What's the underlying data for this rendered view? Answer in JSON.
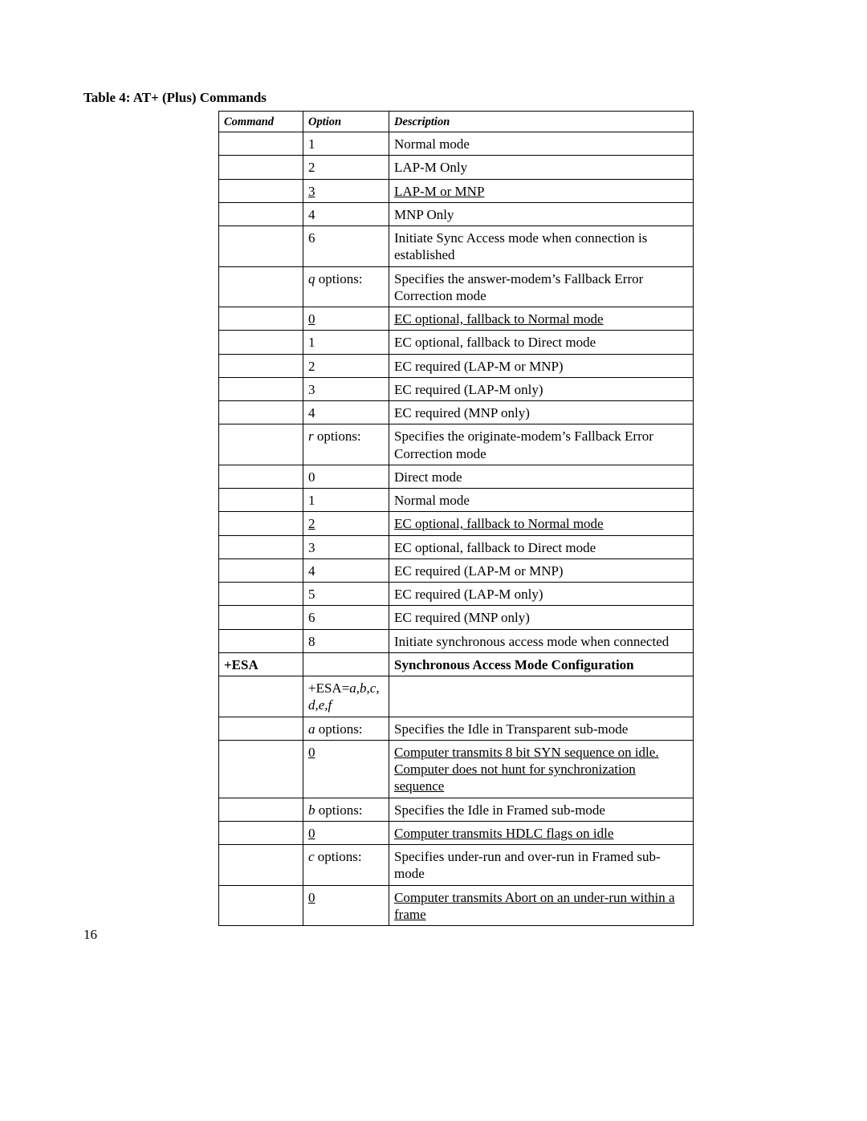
{
  "title": "Table 4: AT+ (Plus) Commands",
  "headers": {
    "command": "Command",
    "option": "Option",
    "description": "Description"
  },
  "pageNumber": "16",
  "rows": [
    {
      "command": "",
      "option": "1",
      "desc": "Normal mode"
    },
    {
      "command": "",
      "option": "2",
      "desc": "LAP-M Only"
    },
    {
      "command": "",
      "option": "3",
      "desc": "LAP-M or MNP",
      "optU": true,
      "descU": true
    },
    {
      "command": "",
      "option": "4",
      "desc": "MNP Only"
    },
    {
      "command": "",
      "option": "6",
      "desc": "Initiate Sync Access mode when connection is established"
    },
    {
      "command": "",
      "optHtml": "<span class='i'>q</span> options:",
      "desc": "Specifies the answer-modem’s Fallback Error Correction mode"
    },
    {
      "command": "",
      "option": "0",
      "desc": "EC optional, fallback to Normal mode",
      "optU": true,
      "descU": true
    },
    {
      "command": "",
      "option": "1",
      "desc": "EC optional, fallback to Direct mode"
    },
    {
      "command": "",
      "option": "2",
      "desc": "EC required (LAP-M or MNP)"
    },
    {
      "command": "",
      "option": "3",
      "desc": "EC required (LAP-M only)"
    },
    {
      "command": "",
      "option": "4",
      "desc": "EC required (MNP only)"
    },
    {
      "command": "",
      "optHtml": "<span class='i'>r</span> options:",
      "desc": "Specifies the originate-modem’s Fallback Error Correction mode"
    },
    {
      "command": "",
      "option": "0",
      "desc": "Direct mode"
    },
    {
      "command": "",
      "option": "1",
      "desc": "Normal mode"
    },
    {
      "command": "",
      "option": "2",
      "desc": "EC optional, fallback to Normal mode",
      "optU": true,
      "descU": true
    },
    {
      "command": "",
      "option": "3",
      "desc": "EC optional, fallback to Direct mode"
    },
    {
      "command": "",
      "option": "4",
      "desc": "EC required (LAP-M or MNP)"
    },
    {
      "command": "",
      "option": "5",
      "desc": "EC required (LAP-M only)"
    },
    {
      "command": "",
      "option": "6",
      "desc": "EC required (MNP only)"
    },
    {
      "command": "",
      "option": "8",
      "desc": "Initiate synchronous access mode when connected"
    },
    {
      "command": "+ESA",
      "option": "",
      "desc": "Synchronous Access Mode Configuration",
      "cmdB": true,
      "descB": true
    },
    {
      "command": "",
      "optHtml": "+ESA=<span class='i'>a,b,c,<br>d,e,f</span>",
      "desc": ""
    },
    {
      "command": "",
      "optHtml": "<span class='i'>a</span> options:",
      "desc": "Specifies the Idle in Transparent sub-mode"
    },
    {
      "command": "",
      "option": "0",
      "desc": "Computer transmits 8 bit SYN sequence on idle. Computer does not hunt for synchronization sequence",
      "optU": true,
      "descU": true
    },
    {
      "command": "",
      "optHtml": "<span class='i'>b</span> options:",
      "desc": "Specifies the Idle in Framed sub-mode"
    },
    {
      "command": "",
      "option": "0",
      "desc": "Computer transmits HDLC flags on idle",
      "optU": true,
      "descU": true
    },
    {
      "command": "",
      "optHtml": "<span class='i'>c</span> options:",
      "desc": "Specifies under-run and over-run in Framed sub-mode"
    },
    {
      "command": "",
      "option": "0",
      "desc": "Computer transmits Abort on an under-run within a frame",
      "optU": true,
      "descU": true
    }
  ]
}
